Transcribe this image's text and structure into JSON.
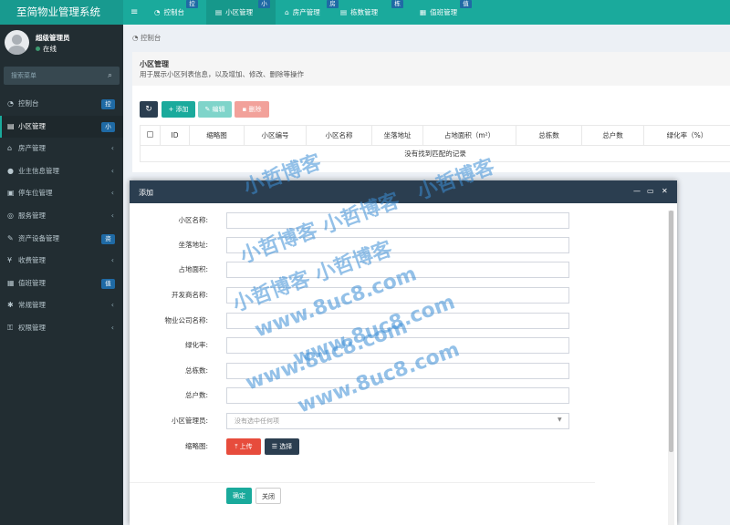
{
  "app": {
    "title": "至简物业管理系统"
  },
  "topnav": {
    "tabs": [
      {
        "label": "控制台",
        "badge": "控"
      },
      {
        "label": "小区管理",
        "badge": "小"
      },
      {
        "label": "房产管理",
        "badge": "房"
      },
      {
        "label": "栋数管理",
        "badge": "栋"
      },
      {
        "label": "值班管理",
        "badge": "值"
      }
    ]
  },
  "user": {
    "name": "超级管理员",
    "status": "在线"
  },
  "search": {
    "placeholder": "搜索菜单"
  },
  "sidebar": {
    "items": [
      {
        "label": "控制台",
        "icon": "dashboard-icon",
        "badge": "控"
      },
      {
        "label": "小区管理",
        "icon": "list-icon",
        "badge": "小"
      },
      {
        "label": "房产管理",
        "icon": "home-icon"
      },
      {
        "label": "业主信息管理",
        "icon": "users-icon"
      },
      {
        "label": "停车位管理",
        "icon": "car-icon"
      },
      {
        "label": "服务管理",
        "icon": "service-icon"
      },
      {
        "label": "资产设备管理",
        "icon": "tools-icon",
        "badge": "资"
      },
      {
        "label": "收费管理",
        "icon": "money-icon"
      },
      {
        "label": "值班管理",
        "icon": "calendar-icon",
        "badge": "值"
      },
      {
        "label": "常规管理",
        "icon": "settings-icon"
      },
      {
        "label": "权限管理",
        "icon": "lock-icon"
      }
    ]
  },
  "breadcrumb": "控制台",
  "panel": {
    "title": "小区管理",
    "description": "用于展示小区列表信息，以及增加、修改、删除等操作"
  },
  "toolbar": {
    "add": "添加",
    "edit": "编辑",
    "delete": "删除"
  },
  "table": {
    "columns": [
      "ID",
      "缩略图",
      "小区编号",
      "小区名称",
      "坐落地址",
      "占地面积（m²）",
      "总栋数",
      "总户数",
      "绿化率（%）"
    ],
    "empty": "没有找到匹配的记录"
  },
  "modal": {
    "title": "添加",
    "fields": [
      {
        "label": "小区名称:",
        "value": ""
      },
      {
        "label": "坐落地址:",
        "value": ""
      },
      {
        "label": "占地面积:",
        "value": ""
      },
      {
        "label": "开发商名称:",
        "value": ""
      },
      {
        "label": "物业公司名称:",
        "value": ""
      },
      {
        "label": "绿化率:",
        "value": ""
      },
      {
        "label": "总栋数:",
        "value": ""
      },
      {
        "label": "总户数:",
        "value": ""
      },
      {
        "label": "小区管理员:",
        "value": "没有选中任何项"
      }
    ],
    "thumbnail_label": "缩略图:",
    "upload": "上传",
    "choose": "选择",
    "confirm": "确定",
    "close": "关闭"
  },
  "watermark": [
    "小哲博客",
    "小哲博客",
    "小哲博客 小哲博客",
    "小哲博客 小哲博客",
    "www.8uc8.com",
    "www.8uc8.com",
    "www.8uc8.com",
    "www.8uc8.com"
  ],
  "colors": {
    "brand": "#1aaa9c",
    "sidebar": "#222d32",
    "modal_header": "#2b3e50",
    "primary_btn": "#1aaa9c",
    "danger_btn": "#e74c3c"
  }
}
